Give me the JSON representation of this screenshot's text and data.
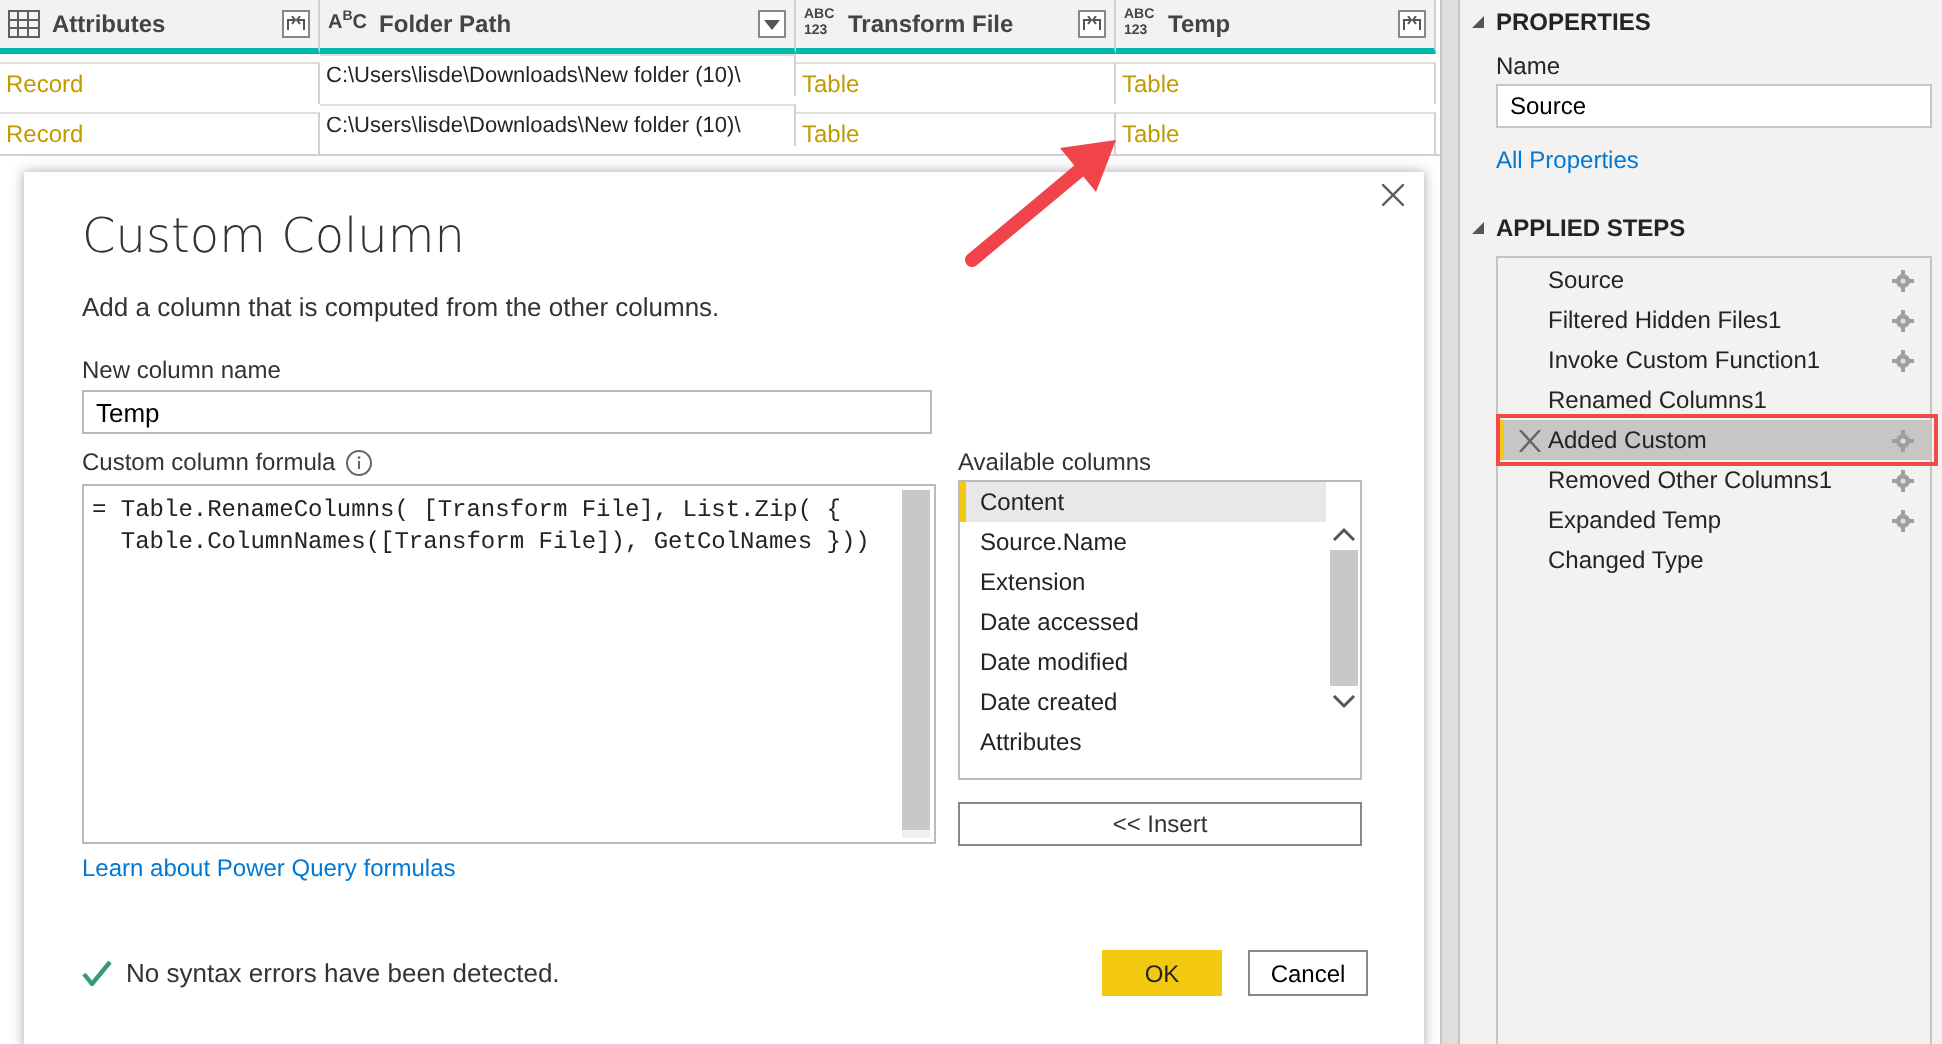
{
  "table": {
    "columns": [
      {
        "label": "Attributes",
        "kind": "table",
        "filterable": false
      },
      {
        "label": "Folder Path",
        "kind": "text",
        "type_badge": "A$^{B}$C",
        "filterable": true
      },
      {
        "label": "Transform File",
        "kind": "any",
        "type_badge": "ABC\n123",
        "filterable": false
      },
      {
        "label": "Temp",
        "kind": "any",
        "type_badge": "ABC\n123",
        "filterable": false
      }
    ],
    "rows": [
      [
        {
          "text": "Record",
          "kind": "link"
        },
        {
          "text": "C:\\Users\\lisde\\Downloads\\New folder (10)\\",
          "kind": "plain"
        },
        {
          "text": "Table",
          "kind": "link"
        },
        {
          "text": "Table",
          "kind": "link"
        }
      ],
      [
        {
          "text": "Record",
          "kind": "link"
        },
        {
          "text": "C:\\Users\\lisde\\Downloads\\New folder (10)\\",
          "kind": "plain"
        },
        {
          "text": "Table",
          "kind": "link"
        },
        {
          "text": "Table",
          "kind": "link"
        }
      ]
    ]
  },
  "dialog": {
    "title": "Custom Column",
    "description": "Add a column that is computed from the other columns.",
    "name_label": "New column name",
    "name_value": "Temp",
    "formula_label": "Custom column formula",
    "formula": "= Table.RenameColumns( [Transform File], List.Zip( {\n  Table.ColumnNames([Transform File]), GetColNames }))",
    "available_label": "Available columns",
    "available_columns": [
      {
        "label": "Content",
        "selected": true
      },
      {
        "label": "Source.Name",
        "selected": false
      },
      {
        "label": "Extension",
        "selected": false
      },
      {
        "label": "Date accessed",
        "selected": false
      },
      {
        "label": "Date modified",
        "selected": false
      },
      {
        "label": "Date created",
        "selected": false
      },
      {
        "label": "Attributes",
        "selected": false
      }
    ],
    "insert_button": "<< Insert",
    "learn_link": "Learn about Power Query formulas",
    "status": "No syntax errors have been detected.",
    "ok_button": "OK",
    "cancel_button": "Cancel"
  },
  "properties": {
    "heading": "PROPERTIES",
    "name_label": "Name",
    "name_value": "Source",
    "all_properties_link": "All Properties"
  },
  "applied_steps": {
    "heading": "APPLIED STEPS",
    "steps": [
      {
        "name": "Source",
        "has_settings": true,
        "selected": false
      },
      {
        "name": "Filtered Hidden Files1",
        "has_settings": true,
        "selected": false
      },
      {
        "name": "Invoke Custom Function1",
        "has_settings": true,
        "selected": false
      },
      {
        "name": "Renamed Columns1",
        "has_settings": false,
        "selected": false
      },
      {
        "name": "Added Custom",
        "has_settings": true,
        "selected": true
      },
      {
        "name": "Removed Other Columns1",
        "has_settings": true,
        "selected": false
      },
      {
        "name": "Expanded Temp",
        "has_settings": true,
        "selected": false
      },
      {
        "name": "Changed Type",
        "has_settings": false,
        "selected": false
      }
    ]
  }
}
